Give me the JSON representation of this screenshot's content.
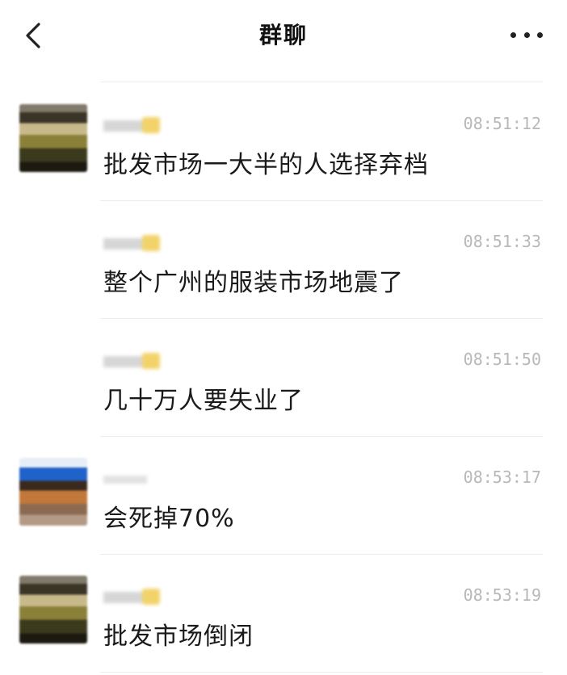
{
  "header": {
    "title": "群聊",
    "back_icon": "chevron-left-icon",
    "more_icon": "more-horizontal-icon"
  },
  "messages": [
    {
      "avatar": "blurred-avatar-a",
      "time": "08:51:12",
      "text": "批发市场一大半的人选择弃档",
      "has_avatar": true
    },
    {
      "avatar": "",
      "time": "08:51:33",
      "text": "整个广州的服装市场地震了",
      "has_avatar": false
    },
    {
      "avatar": "",
      "time": "08:51:50",
      "text": "几十万人要失业了",
      "has_avatar": false
    },
    {
      "avatar": "blurred-avatar-b",
      "time": "08:53:17",
      "text": "会死掉70%",
      "has_avatar": true
    },
    {
      "avatar": "blurred-avatar-a",
      "time": "08:53:19",
      "text": "批发市场倒闭",
      "has_avatar": true
    }
  ],
  "colors": {
    "background": "#ffffff",
    "divider": "#ececec",
    "timestamp": "#b8b8b8",
    "text": "#1a1a1a"
  }
}
